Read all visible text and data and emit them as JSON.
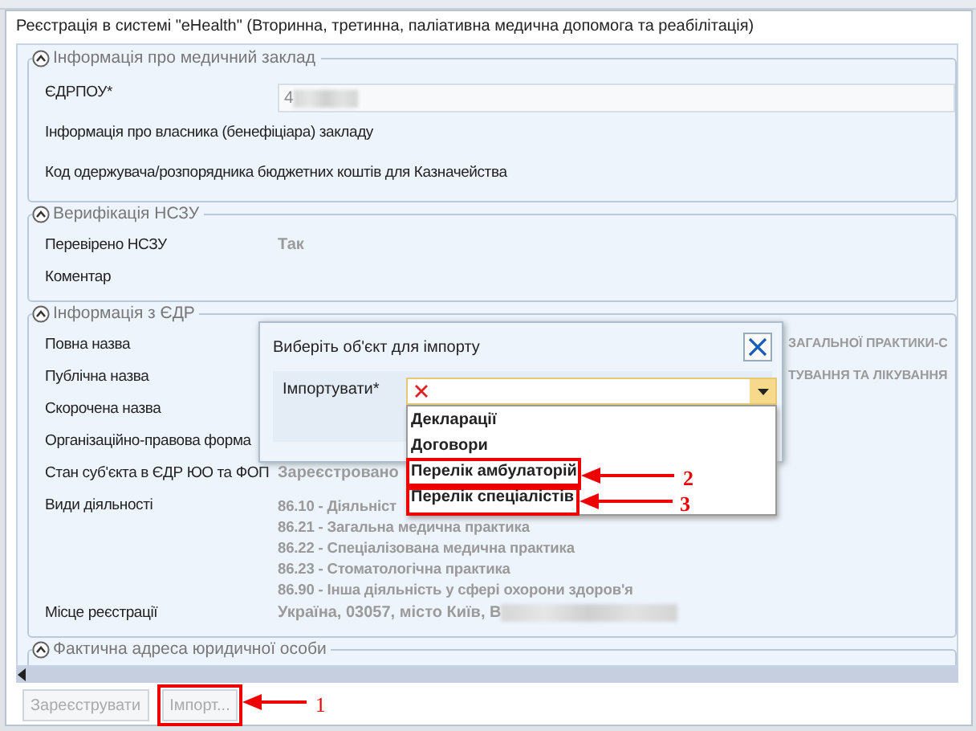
{
  "window": {
    "title": "Реєстрація в системі \"eHealth\" (Вторинна, третинна, паліативна медична допомога та реабілітація)"
  },
  "sections": [
    {
      "title": "Інформація про медичний заклад",
      "expanded": true,
      "rows": [
        {
          "kind": "field",
          "label": "ЄДРПОУ*",
          "value": "4",
          "redacted": true
        },
        {
          "kind": "text",
          "label": "Інформація про власника (бенефіціара) закладу"
        },
        {
          "kind": "text",
          "label": "Код одержувача/розпорядника бюджетних коштів для Казначейства"
        }
      ]
    },
    {
      "title": "Верифікація НСЗУ",
      "expanded": true,
      "rows": [
        {
          "kind": "text",
          "label": "Перевірено НСЗУ",
          "value": "Так"
        },
        {
          "kind": "text",
          "label": "Коментар"
        }
      ]
    },
    {
      "title": "Інформація з ЄДР",
      "expanded": true,
      "rows": [
        {
          "kind": "far",
          "label": "Повна назва",
          "value": "ЗАГАЛЬНОЇ ПРАКТИКИ-С"
        },
        {
          "kind": "far",
          "label": "Публічна назва",
          "value": "ТУВАННЯ ТА ЛІКУВАННЯ"
        },
        {
          "kind": "text",
          "label": "Скорочена назва"
        },
        {
          "kind": "text",
          "label": "Організаційно-правова форма"
        },
        {
          "kind": "text",
          "label": "Стан суб'єкта в ЄДР ЮО та ФОП",
          "value": "Зареєстровано"
        },
        {
          "kind": "list",
          "label": "Види діяльності",
          "values": [
            "86.10 - Діяльніст",
            "86.21 - Загальна медична практика",
            "86.22 - Спеціалізована медична практика",
            "86.23 - Стоматологічна практика",
            "86.90 - Інша діяльність у сфері охорони здоров'я"
          ]
        },
        {
          "kind": "text",
          "label": "Місце реєстрації",
          "value": "Україна, 03057, місто Київ, В",
          "redacted": true
        }
      ]
    },
    {
      "title": "Фактична адреса юридичної особи",
      "expanded": true
    }
  ],
  "dialog": {
    "title": "Виберіть об'єкт для імпорту",
    "field_label": "Імпортувати*",
    "options": [
      {
        "label": "Декларації"
      },
      {
        "label": "Договори"
      },
      {
        "label": "Перелік амбулаторій",
        "callout": "2"
      },
      {
        "label": "Перелік спеціалістів",
        "callout": "3"
      }
    ]
  },
  "buttons": [
    {
      "label": "Зареєструвати",
      "disabled": true
    },
    {
      "label": "Імпорт...",
      "disabled": true,
      "callout": "1"
    }
  ]
}
